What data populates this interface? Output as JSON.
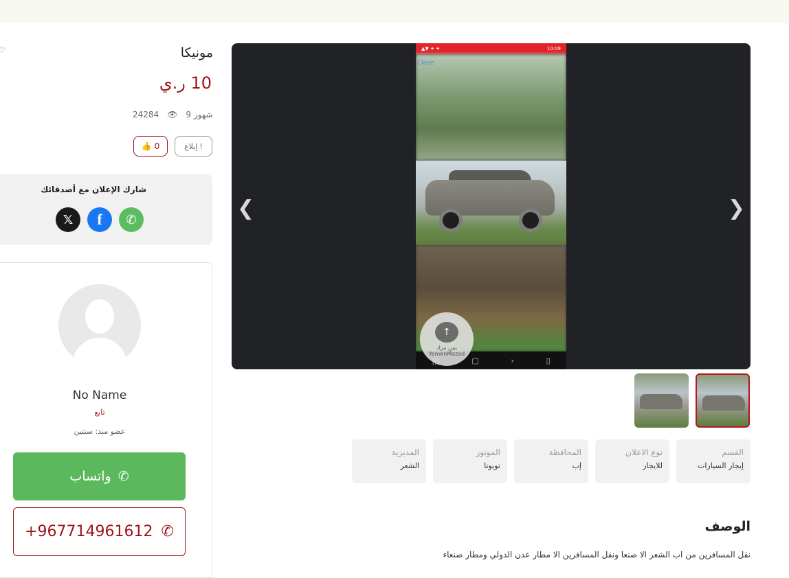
{
  "ad": {
    "title": "مونيكا",
    "price": "10 ر.ي",
    "age": "9 شهور",
    "views": "24284",
    "report_label": "إبلاغ",
    "likes": "0"
  },
  "share": {
    "title": "شارك الإعلان مع أصدقائك",
    "networks": [
      "x-icon",
      "facebook-icon",
      "whatsapp-icon"
    ]
  },
  "seller": {
    "name": "No Name",
    "role": "تابع",
    "member_since": "عضو منذ: سنتين",
    "whatsapp_label": "واتساب",
    "phone": "+967714961612"
  },
  "gallery": {
    "close_label": "Close",
    "watermark": "يمن مزاد",
    "watermark_sub": "YemenMazad"
  },
  "details": [
    {
      "label": "القسم",
      "value": "إيجار السيارات"
    },
    {
      "label": "نوع الاعلان",
      "value": "للايجار"
    },
    {
      "label": "المحافظة",
      "value": "إب"
    },
    {
      "label": "الموتور",
      "value": "تويوتا"
    },
    {
      "label": "المديرية",
      "value": "الشعر"
    }
  ],
  "description": {
    "title": "الوصف",
    "text": "نقل المسافرين من اب الشعر الا صنعا ونقل المسافرين الا مطار عدن الدولي ومطار صنعاء"
  },
  "colors": {
    "accent": "#9e1318",
    "whatsapp": "#5cb85c",
    "facebook": "#1877f2"
  }
}
